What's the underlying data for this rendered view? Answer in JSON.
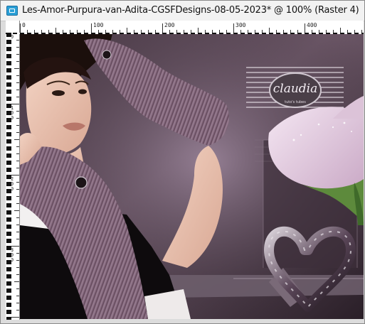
{
  "window": {
    "title": "Les-Amor-Purpura-van-Adita-CGSFDesigns-08-05-2023* @ 100% (Raster 4)"
  },
  "ruler": {
    "top_labels": [
      "0",
      "100",
      "200",
      "300",
      "400"
    ],
    "left_labels": [
      "0",
      "1\n0\n0",
      "2\n0\n0",
      "3\n0\n0"
    ]
  },
  "artwork": {
    "watermark_text": "claudia",
    "watermark_sub": "tuto's  tubes"
  },
  "icons": {
    "app_icon": "image-document-icon"
  }
}
